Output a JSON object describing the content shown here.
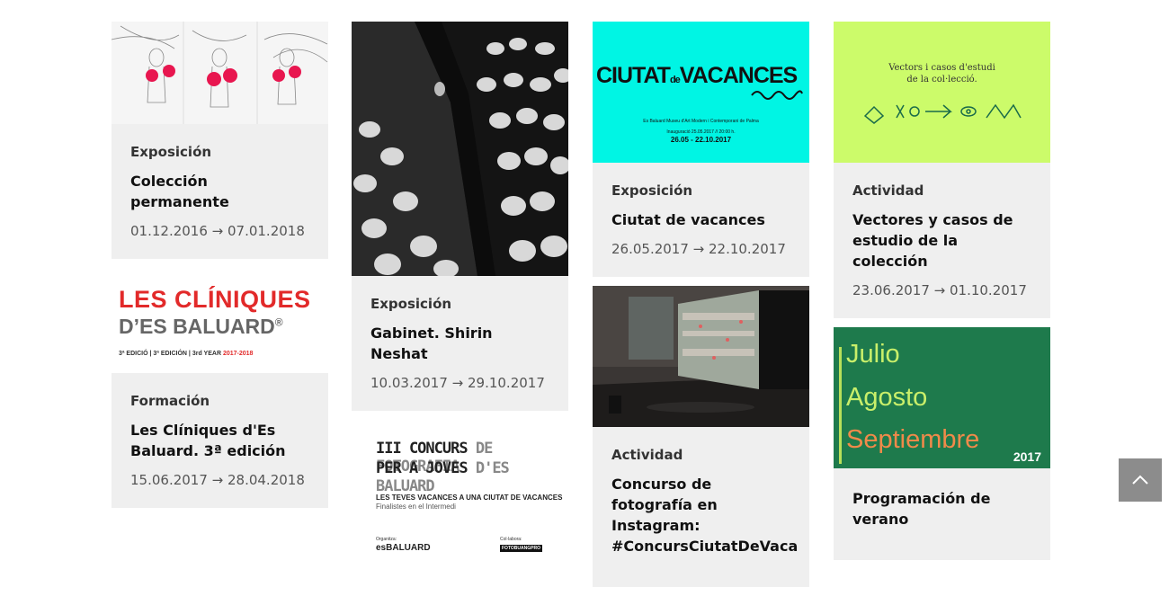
{
  "cards": [
    {
      "category": "Exposición",
      "title": "Colección permanente",
      "dates": "01.12.2016 → 07.01.2018"
    },
    {
      "category": "Formación",
      "title": "Les Clíniques d'Es Baluard. 3ª edición",
      "dates": "15.06.2017 → 28.04.2018",
      "thumb": {
        "line1": "LES CLÍNIQUES",
        "line2": "D’ES BALUARD",
        "reg": "®",
        "line3a": "3ª EDICIÓ | 3ª EDICIÓN | 3rd YEAR",
        "line3b": "2017-2018"
      }
    },
    {
      "category": "Exposición",
      "title": "Gabinet. Shirin Neshat",
      "dates": "10.03.2017 → 29.10.2017"
    },
    {
      "thumb": {
        "l1a": "III CONCURS",
        "l1b": "DE FOTOGRAFIA",
        "l2a": "PER A JOVES",
        "l2b": "D'ES BALUARD",
        "l3": "LES TEVES VACANCES A UNA CIUTAT DE VACANCES",
        "l4": "Finalistes en el Intermedi",
        "org": "Organitza:",
        "logo": "esBALUARD",
        "col": "Col·labora:",
        "logo2": "FOTOBUANGPRO"
      }
    },
    {
      "category": "Exposición",
      "title": "Ciutat de vacances",
      "dates": "26.05.2017 → 22.10.2017",
      "thumb": {
        "t1": "CIUTAT",
        "t2": "de",
        "t3": "VACANCES",
        "s1": "Es Baluard Museu d'Art Modern i Contemporani de Palma",
        "s2": "Inauguració 25.05.2017 // 20:00 h.",
        "s3": "26.05 - 22.10.2017"
      }
    },
    {
      "category": "Actividad",
      "title": "Concurso de fotografía en Instagram: #ConcursCiutatDeVaca"
    },
    {
      "category": "Actividad",
      "title": "Vectores y casos de estudio de la colección",
      "dates": "23.06.2017 → 01.10.2017",
      "thumb": {
        "l1": "Vectors i casos d'estudi",
        "l2": "de la col·lecció."
      }
    },
    {
      "title": "Programación de verano",
      "thumb": {
        "m1": "Julio",
        "m2": "Agosto",
        "m3": "Septiembre",
        "year": "2017"
      }
    }
  ],
  "colors": {
    "cyan": "#00f5e4",
    "lime": "#ccfb6a",
    "green": "#1e7a4c",
    "red": "#e22a2a"
  },
  "icons": {
    "totop": "chevron-up-icon"
  }
}
